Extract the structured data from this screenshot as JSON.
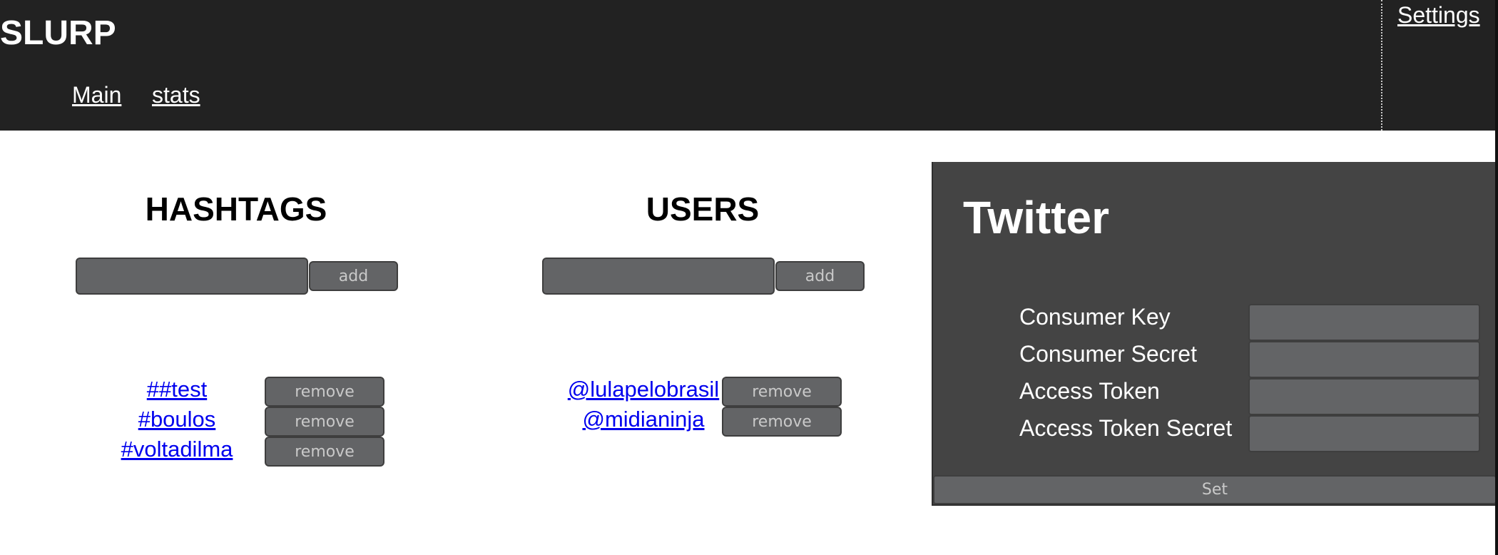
{
  "header": {
    "app_title": "SLURP",
    "nav": [
      {
        "label": "Main"
      },
      {
        "label": "stats"
      }
    ],
    "settings_label": "Settings"
  },
  "hashtags": {
    "heading": "HASHTAGS",
    "input_value": "",
    "add_label": "add",
    "items": [
      {
        "label": "##test",
        "remove_label": "remove"
      },
      {
        "label": "#boulos",
        "remove_label": "remove"
      },
      {
        "label": "#voltadilma",
        "remove_label": "remove"
      }
    ]
  },
  "users": {
    "heading": "USERS",
    "input_value": "",
    "add_label": "add",
    "items": [
      {
        "label": "@lulapelobrasil",
        "remove_label": "remove"
      },
      {
        "label": "@midianinja",
        "remove_label": "remove"
      }
    ]
  },
  "twitter": {
    "title": "Twitter",
    "fields": [
      {
        "label": "Consumer Key",
        "value": ""
      },
      {
        "label": "Consumer Secret",
        "value": ""
      },
      {
        "label": "Access Token",
        "value": ""
      },
      {
        "label": "Access Token Secret",
        "value": ""
      }
    ],
    "set_label": "Set"
  },
  "colors": {
    "header_bg": "#222222",
    "panel_bg": "#444444",
    "button_bg": "#636466",
    "link": "#0000ee"
  }
}
